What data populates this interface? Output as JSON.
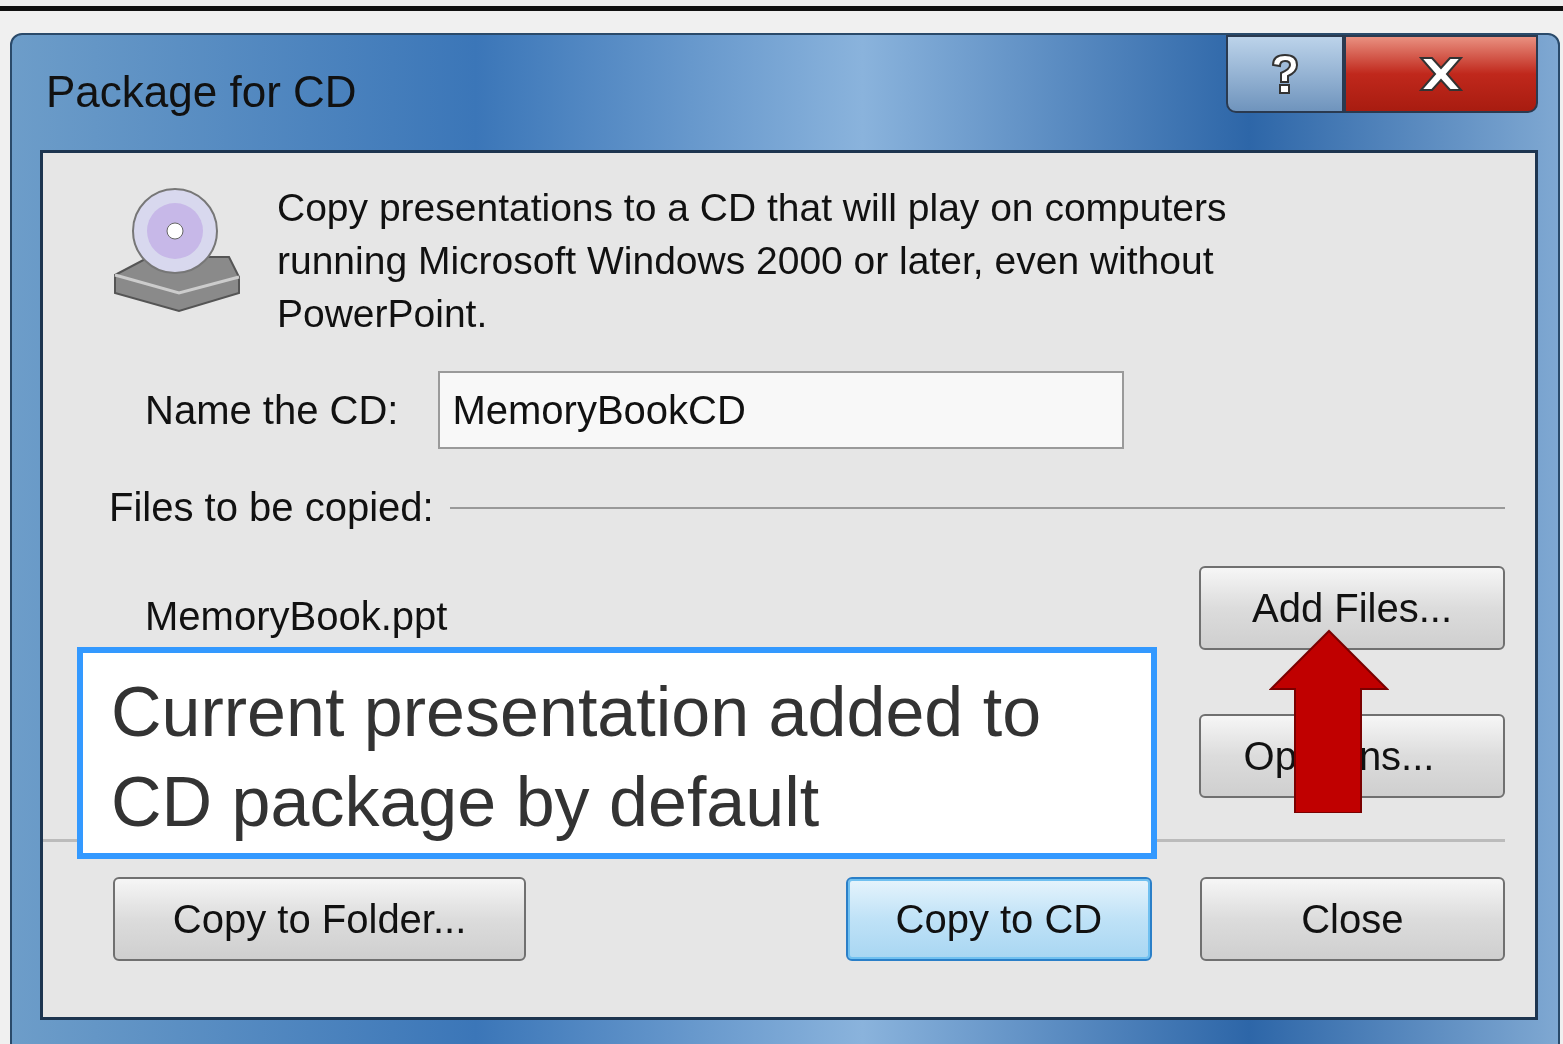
{
  "window": {
    "title": "Package for CD"
  },
  "description": "Copy presentations to a CD that will play on computers running Microsoft Windows 2000 or later, even without PowerPoint.",
  "name_field": {
    "label": "Name the CD:",
    "value": "MemoryBookCD"
  },
  "files_group": {
    "label": "Files to be copied:",
    "files": [
      "MemoryBook.ppt"
    ],
    "side_buttons": [
      {
        "parts": [
          "Add Files..."
        ]
      },
      {
        "parts": [
          "Op",
          "ns..."
        ]
      }
    ]
  },
  "callout": {
    "text": "Current presentation added to CD package by default"
  },
  "buttons": [
    {
      "label": "Copy to Folder...",
      "default": false
    },
    {
      "label": "Copy to CD",
      "default": true
    },
    {
      "label": "Close",
      "default": false
    }
  ]
}
